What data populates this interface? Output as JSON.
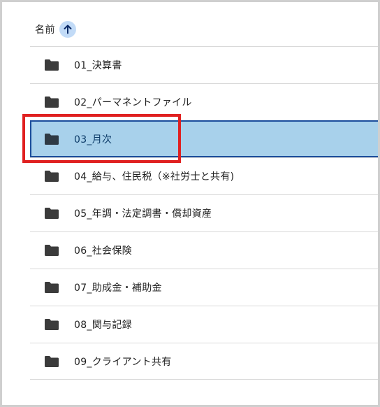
{
  "header": {
    "name_label": "名前",
    "sort_icon": "arrow-up-icon"
  },
  "folders": [
    {
      "label": "01_決算書"
    },
    {
      "label": "02_パーマネントファイル"
    },
    {
      "label": "03_月次",
      "selected": true
    },
    {
      "label": "04_給与、住民税（※社労士と共有)"
    },
    {
      "label": "05_年調・法定調書・償却資産"
    },
    {
      "label": "06_社会保険"
    },
    {
      "label": "07_助成金・補助金"
    },
    {
      "label": "08_関与記録"
    },
    {
      "label": "09_クライアント共有"
    }
  ],
  "colors": {
    "selected_bg": "#a8d1eb",
    "selected_border": "#1c4e9c",
    "highlight": "#e02020",
    "sort_button_bg": "#c2dbf7"
  }
}
